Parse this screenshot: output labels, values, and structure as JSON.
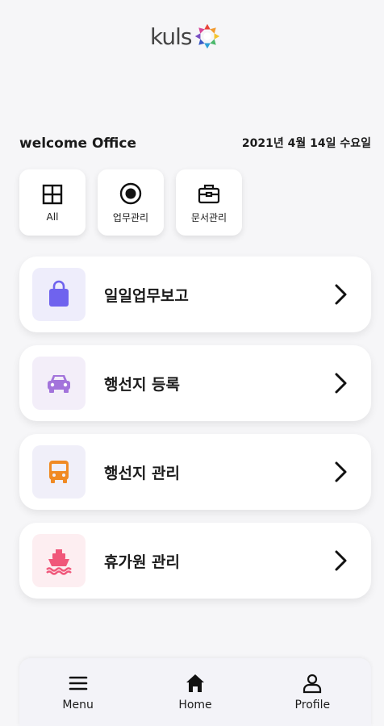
{
  "logo": {
    "text": "kuls"
  },
  "header": {
    "welcome": "welcome Office",
    "date": "2021년 4월 14일 수요일"
  },
  "chips": [
    {
      "label": "All",
      "icon": "grid-icon"
    },
    {
      "label": "업무관리",
      "icon": "radio-target-icon"
    },
    {
      "label": "문서관리",
      "icon": "briefcase-icon"
    }
  ],
  "menu": [
    {
      "label": "일일업무보고",
      "icon": "shopping-bag-icon",
      "icon_color": "#6f63ee",
      "bg_color": "#eeedfb"
    },
    {
      "label": "행선지 등록",
      "icon": "car-icon",
      "icon_color": "#a374db",
      "bg_color": "#f3eef9"
    },
    {
      "label": "행선지 관리",
      "icon": "bus-icon",
      "icon_color": "#f08a24",
      "bg_color": "#f0eff9"
    },
    {
      "label": "휴가원 관리",
      "icon": "ship-icon",
      "icon_color": "#f0577a",
      "bg_color": "#fdeef1"
    }
  ],
  "nav": [
    {
      "label": "Menu",
      "icon": "hamburger-icon"
    },
    {
      "label": "Home",
      "icon": "home-icon"
    },
    {
      "label": "Profile",
      "icon": "person-icon"
    }
  ]
}
